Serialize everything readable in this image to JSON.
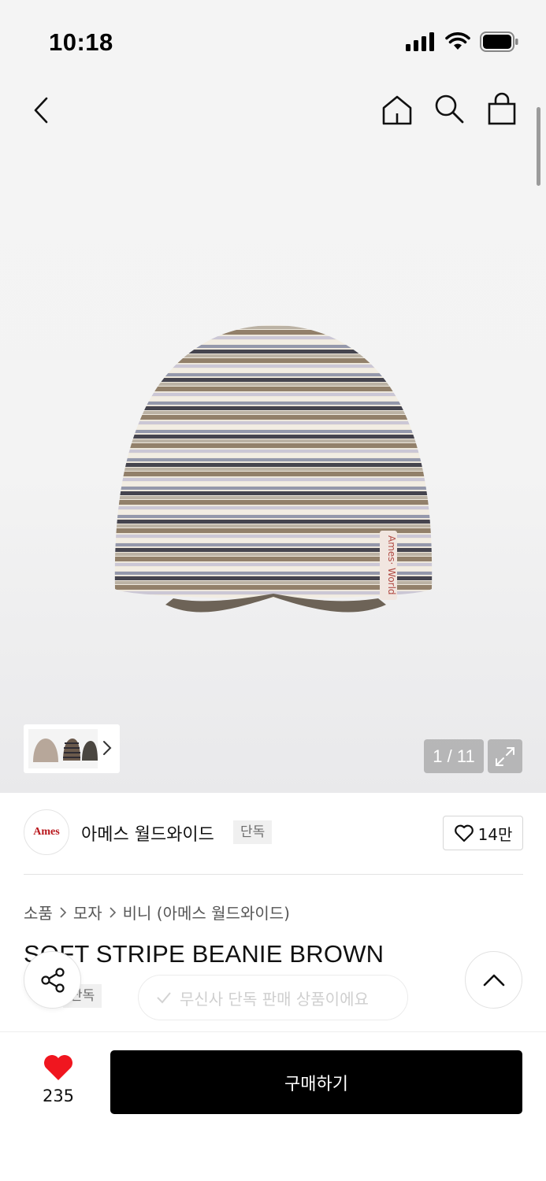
{
  "status_bar": {
    "time": "10:18",
    "icons": [
      "signal-icon",
      "wifi-icon",
      "battery-icon"
    ]
  },
  "header": {
    "icons": [
      "back-icon",
      "home-icon",
      "search-icon",
      "shopping-bag-icon"
    ]
  },
  "gallery": {
    "counter": "1 / 11"
  },
  "brand": {
    "logo_text": "Ames",
    "name": "아메스 월드와이드",
    "badge": "단독",
    "like_count": "14만"
  },
  "breadcrumb": [
    "소품",
    "모자",
    "비니 (아메스 월드와이드)"
  ],
  "product": {
    "title": "SOFT STRIPE BEANIE BROWN",
    "exclusive_tag": "단독",
    "exclusive_note": "무신사 단독 판매 상품이에요"
  },
  "bottom_bar": {
    "wish_count": "235",
    "buy_label": "구매하기"
  },
  "colors": {
    "accent_heart": "#f0161f",
    "buy_button": "#000000",
    "brand_red": "#b8161b"
  }
}
